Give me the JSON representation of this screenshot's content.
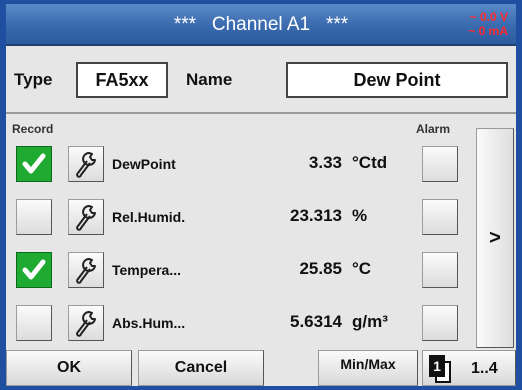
{
  "title": {
    "decor_left": "***",
    "text": "Channel A1",
    "decor_right": "***"
  },
  "readout": {
    "voltage": "~ 0.0 V",
    "current": "~ 0 mA"
  },
  "fields": {
    "type_label": "Type",
    "type_value": "FA5xx",
    "name_label": "Name",
    "name_value": "Dew Point"
  },
  "headers": {
    "record": "Record",
    "alarm": "Alarm"
  },
  "rows": [
    {
      "name": "DewPoint",
      "value": "3.33",
      "unit": "°Ctd",
      "record": true,
      "alarm": false
    },
    {
      "name": "Rel.Humid.",
      "value": "23.313",
      "unit": "%",
      "record": false,
      "alarm": false
    },
    {
      "name": "Tempera...",
      "value": "25.85",
      "unit": "°C",
      "record": true,
      "alarm": false
    },
    {
      "name": "Abs.Hum...",
      "value": "5.6314",
      "unit": "g/m³",
      "record": false,
      "alarm": false
    }
  ],
  "next_label": ">",
  "bottom": {
    "ok": "OK",
    "cancel": "Cancel",
    "minmax": "Min/Max",
    "page_num": "1",
    "page_range": "1..4"
  },
  "colors": {
    "title_bar": "#3a6aae",
    "check_green": "#1faa32",
    "readout_red": "#ff2a2a"
  }
}
